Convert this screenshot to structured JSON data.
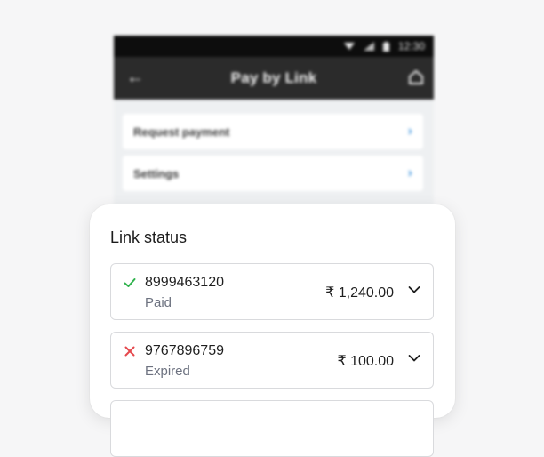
{
  "phone": {
    "status_time": "12:30",
    "title": "Pay by Link",
    "menu": [
      {
        "label": "Request payment"
      },
      {
        "label": "Settings"
      }
    ]
  },
  "sheet": {
    "title": "Link status",
    "links": [
      {
        "number": "8999463120",
        "status": "Paid",
        "amount": "₹ 1,240.00",
        "status_color": "#2fb24c",
        "icon": "check-icon"
      },
      {
        "number": "9767896759",
        "status": "Expired",
        "amount": "₹ 100.00",
        "status_color": "#e5484d",
        "icon": "cross-icon"
      }
    ]
  }
}
